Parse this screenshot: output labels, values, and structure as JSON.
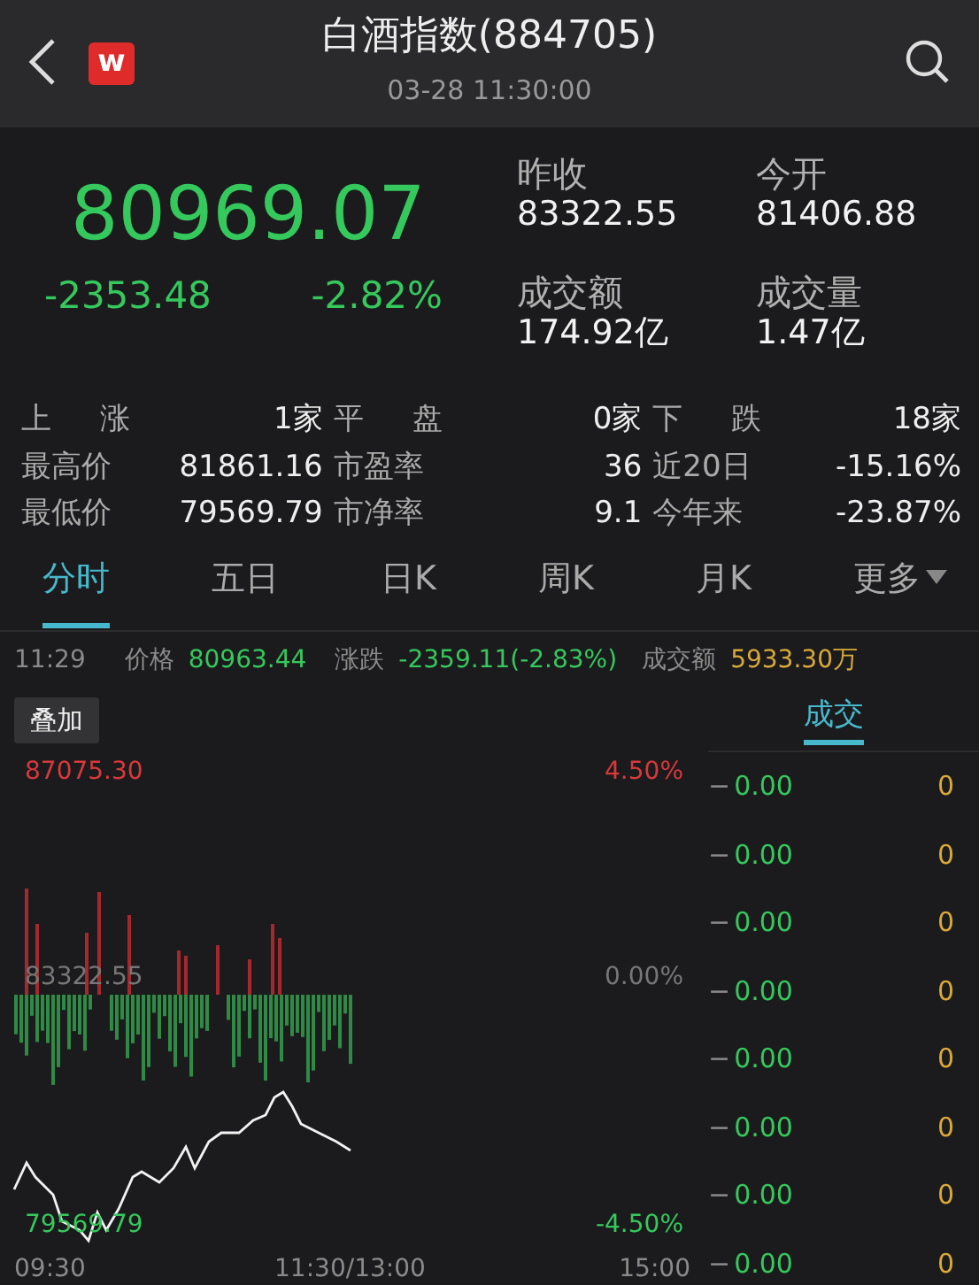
{
  "header": {
    "logo": "w",
    "title": "白酒指数(884705)",
    "time": "03-28 11:30:00"
  },
  "quote": {
    "price": "80969.07",
    "change": "-2353.48",
    "change_pct": "-2.82%",
    "fields": [
      {
        "label": "昨收",
        "value": "83322.55"
      },
      {
        "label": "今开",
        "value": "81406.88"
      },
      {
        "label": "成交额",
        "value": "174.92亿"
      },
      {
        "label": "成交量",
        "value": "1.47亿"
      }
    ]
  },
  "stats": [
    {
      "label": "上 涨",
      "value": "1家"
    },
    {
      "label": "平 盘",
      "value": "0家"
    },
    {
      "label": "下 跌",
      "value": "18家"
    },
    {
      "label": "最高价",
      "value": "81861.16"
    },
    {
      "label": "市盈率",
      "value": "36"
    },
    {
      "label": "近20日",
      "value": "-15.16%"
    },
    {
      "label": "最低价",
      "value": "79569.79"
    },
    {
      "label": "市净率",
      "value": "9.1"
    },
    {
      "label": "今年来",
      "value": "-23.87%"
    }
  ],
  "tabs": [
    {
      "label": "分时",
      "selected": true,
      "dropdown": false
    },
    {
      "label": "五日",
      "selected": false,
      "dropdown": false
    },
    {
      "label": "日K",
      "selected": false,
      "dropdown": false
    },
    {
      "label": "周K",
      "selected": false,
      "dropdown": false
    },
    {
      "label": "月K",
      "selected": false,
      "dropdown": false
    },
    {
      "label": "更多",
      "selected": false,
      "dropdown": true
    }
  ],
  "crosshair": {
    "time": "11:29",
    "price_label": "价格",
    "price": "80963.44",
    "change_label": "涨跌",
    "change": "-2359.11(-2.83%)",
    "amount_label": "成交额",
    "amount": "5933.30万"
  },
  "overlay_button": "叠加",
  "side_tab": {
    "label": "成交",
    "selected": true
  },
  "chart": {
    "y_labels": [
      {
        "price": "87075.30",
        "pct": "4.50%",
        "kind": "up"
      },
      {
        "price": "83322.55",
        "pct": "0.00%",
        "kind": "flat"
      },
      {
        "price": "79569.79",
        "pct": "-4.50%",
        "kind": "down"
      }
    ],
    "x_labels": [
      "09:30",
      "11:30/13:00",
      "15:00"
    ]
  },
  "trades": [
    {
      "mark": "−",
      "price": "0.00",
      "volume": "0"
    },
    {
      "mark": "−",
      "price": "0.00",
      "volume": "0"
    },
    {
      "mark": "−",
      "price": "0.00",
      "volume": "0"
    },
    {
      "mark": "−",
      "price": "0.00",
      "volume": "0"
    },
    {
      "mark": "−",
      "price": "0.00",
      "volume": "0"
    },
    {
      "mark": "−",
      "price": "0.00",
      "volume": "0"
    },
    {
      "mark": "−",
      "price": "0.00",
      "volume": "0"
    },
    {
      "mark": "−",
      "price": "0.00",
      "volume": "0"
    }
  ]
}
